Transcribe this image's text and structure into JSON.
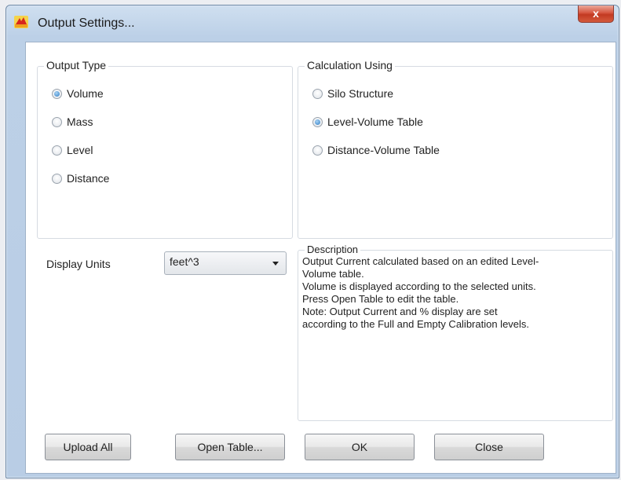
{
  "window": {
    "title": "Output Settings...",
    "close_label": "x"
  },
  "output_type": {
    "label": "Output Type",
    "options": [
      {
        "label": "Volume",
        "selected": true
      },
      {
        "label": "Mass",
        "selected": false
      },
      {
        "label": "Level",
        "selected": false
      },
      {
        "label": "Distance",
        "selected": false
      }
    ]
  },
  "calculation_using": {
    "label": "Calculation Using",
    "options": [
      {
        "label": "Silo Structure",
        "selected": false
      },
      {
        "label": "Level-Volume Table",
        "selected": true
      },
      {
        "label": "Distance-Volume Table",
        "selected": false
      }
    ]
  },
  "display_units": {
    "label": "Display Units",
    "selected": "feet^3"
  },
  "description": {
    "label": "Description",
    "lines": [
      "Output Current calculated based on an edited Level-",
      "Volume table.",
      "Volume is displayed according to the selected units.",
      "Press Open Table to edit the table.",
      "Note: Output Current and % display are set",
      "according to the Full and Empty Calibration levels."
    ]
  },
  "buttons": {
    "upload_all": "Upload All",
    "open_table": "Open Table...",
    "ok": "OK",
    "close": "Close"
  }
}
